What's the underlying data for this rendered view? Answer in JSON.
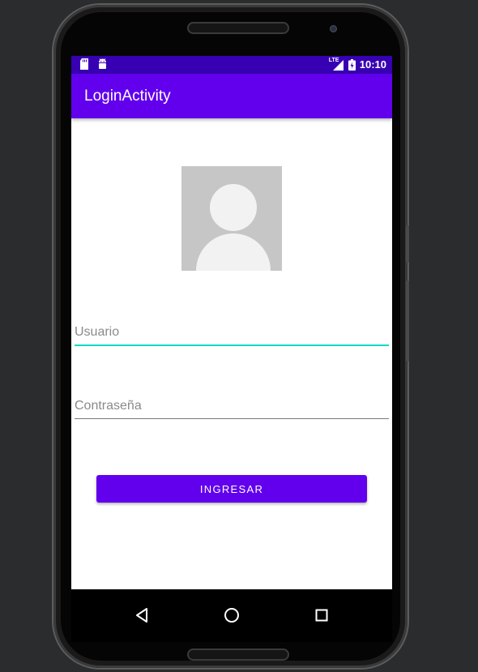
{
  "status_bar": {
    "time": "10:10",
    "network": "LTE",
    "left_icons": [
      "sd-card-icon",
      "android-icon"
    ],
    "right_icons": [
      "signal-icon",
      "battery-icon"
    ],
    "color": "#3700b3"
  },
  "app_bar": {
    "title": "LoginActivity",
    "color": "#6200ee"
  },
  "form": {
    "avatar_icon": "default-avatar-icon",
    "username": {
      "placeholder": "Usuario",
      "value": ""
    },
    "password": {
      "placeholder": "Contraseña",
      "value": ""
    },
    "submit_label": "INGRESAR",
    "accent_color": "#03dac5"
  },
  "nav_bar": {
    "buttons": [
      "back-icon",
      "home-icon",
      "recents-icon"
    ]
  }
}
